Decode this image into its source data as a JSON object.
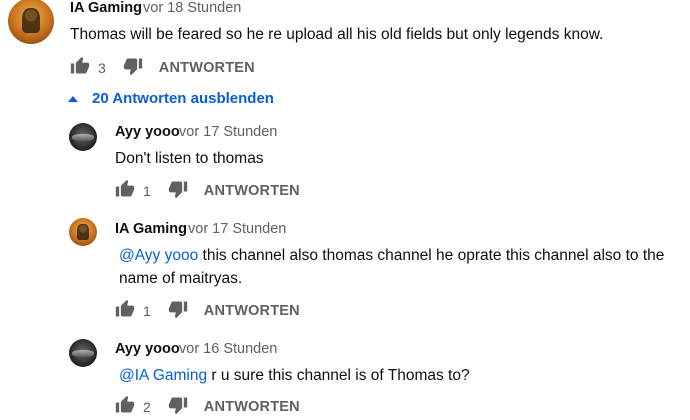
{
  "top_comment": {
    "author": "IA Gaming",
    "time": "vor 18 Stunden",
    "text": "Thomas will be feared so he re upload all his old fields but only legends know.",
    "likes": "3",
    "reply_label": "ANTWORTEN"
  },
  "replies_toggle": {
    "label": "20 Antworten ausblenden"
  },
  "replies": [
    {
      "author": "Ayy yooo",
      "time": "vor 17 Stunden",
      "text": "Don't listen to thomas",
      "likes": "1",
      "reply_label": "ANTWORTEN"
    },
    {
      "author": "IA Gaming",
      "time": "vor 17 Stunden",
      "mention": "@Ayy yooo",
      "text_line1": " this channel also thomas channel he oprate this channel also to the",
      "text_line2": "name of maitryas.",
      "likes": "1",
      "reply_label": "ANTWORTEN"
    },
    {
      "author": "Ayy yooo",
      "time": "vor 16 Stunden",
      "mention": "@IA Gaming",
      "text": " r u sure this channel is of Thomas to?",
      "likes": "2",
      "reply_label": "ANTWORTEN"
    }
  ],
  "icons": {
    "like": "thumbs-up-icon",
    "dislike": "thumbs-down-icon",
    "toggle": "chevron-up-icon"
  },
  "colors": {
    "link": "#065fd4",
    "secondary_text": "#606060",
    "primary_text": "#0f0f0f"
  }
}
